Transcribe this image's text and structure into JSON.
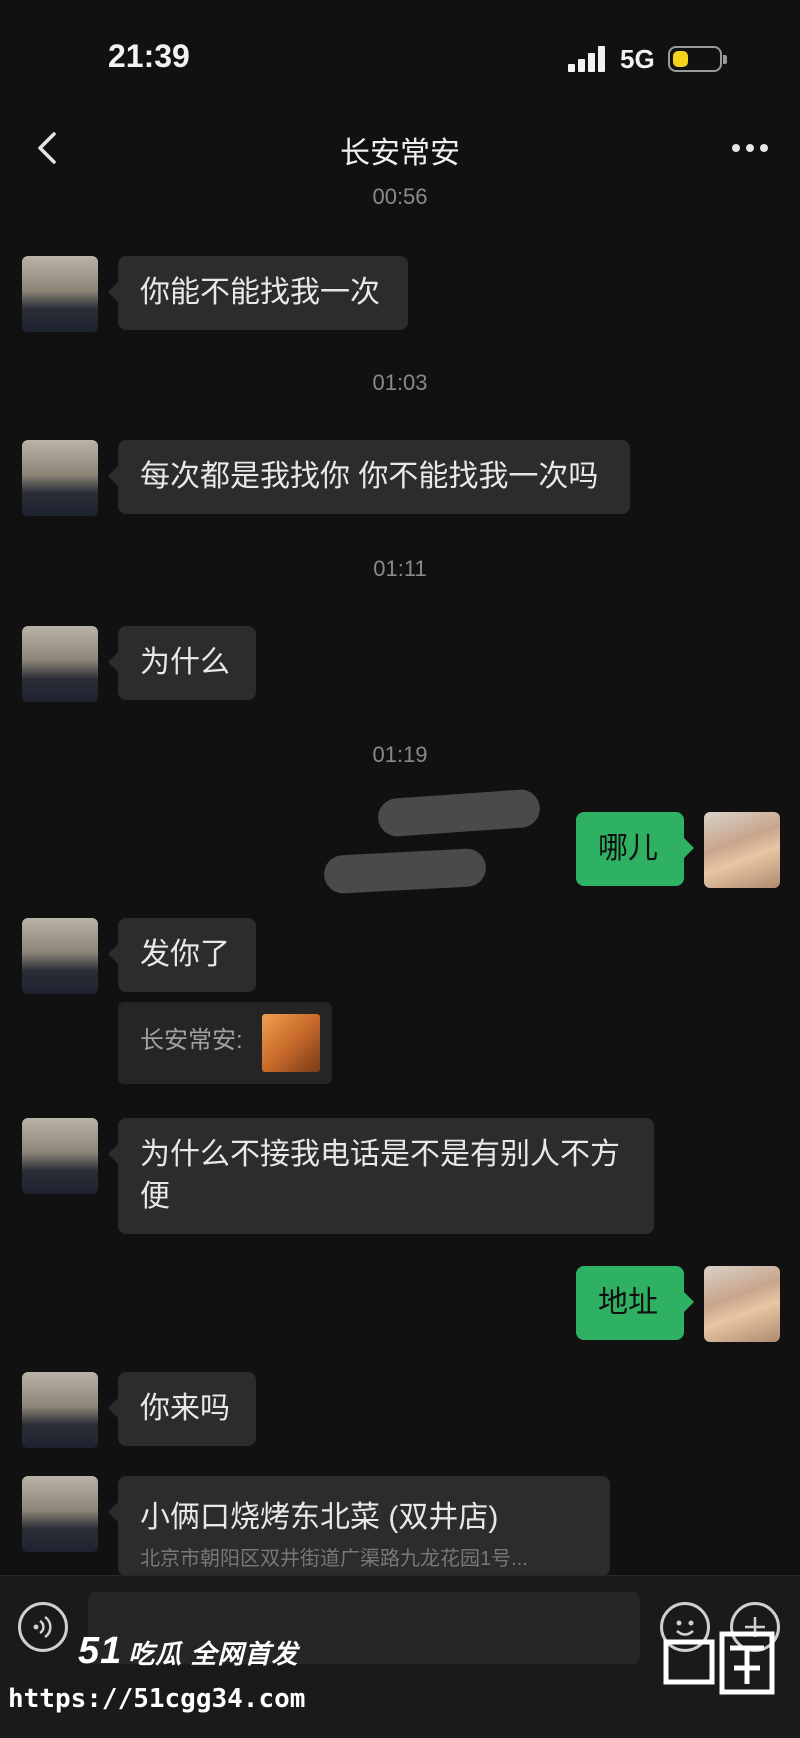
{
  "status_bar": {
    "time": "21:39",
    "network": "5G",
    "battery_level": 0.35,
    "battery_color": "#f5d21a"
  },
  "nav": {
    "back_icon": "chevron-left-icon",
    "title": "长安常安",
    "more_icon": "more-horizontal-icon"
  },
  "chat": {
    "timestamps": [
      "00:56",
      "01:03",
      "01:11",
      "01:19"
    ],
    "messages": [
      {
        "from": "contact",
        "text": "你能不能找我一次"
      },
      {
        "from": "contact",
        "text": "每次都是我找你 你不能找我一次吗"
      },
      {
        "from": "contact",
        "text": "为什么"
      },
      {
        "from": "me",
        "text": "哪儿"
      },
      {
        "from": "contact",
        "text": "发你了"
      },
      {
        "from": "contact",
        "text": "为什么不接我电话是不是有别人不方"
      },
      {
        "from": "contact",
        "text": "便"
      },
      {
        "from": "me",
        "text": "地址"
      },
      {
        "from": "contact",
        "text": "你来吗"
      }
    ],
    "quote": {
      "sender": "长安常安:"
    },
    "location_card": {
      "name": "小俩口烧烤东北菜 (双井店)",
      "address": "北京市朝阳区双井街道广渠路九龙花园1号..."
    },
    "bubble_color_out": "#2fb163",
    "bubble_color_in": "#2c2c2c"
  },
  "input_bar": {
    "voice_icon": "voice-icon",
    "emoji_icon": "emoji-icon",
    "plus_icon": "plus-icon"
  },
  "watermark": {
    "logo": "51",
    "tagline": "吃瓜 全网首发",
    "url": "https://51cgg34.com"
  }
}
